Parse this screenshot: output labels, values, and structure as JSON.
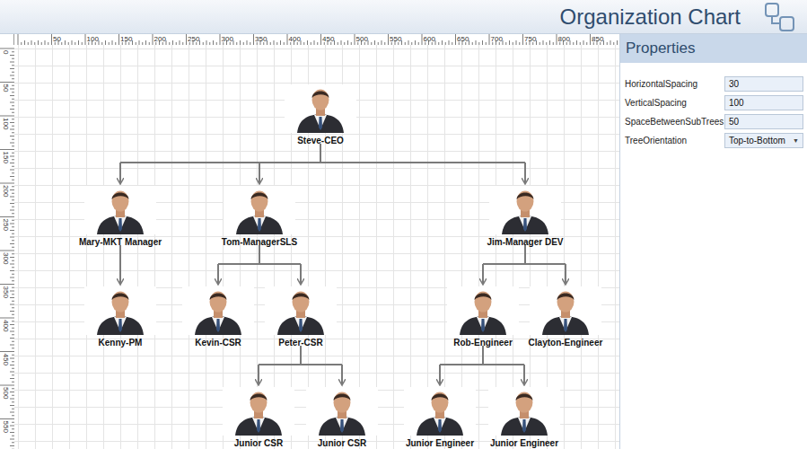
{
  "window": {
    "title": "Organization Chart"
  },
  "rulers": {
    "top": [
      "50",
      "100",
      "150",
      "200",
      "250",
      "300",
      "350",
      "400",
      "450",
      "500",
      "550",
      "600",
      "650",
      "700",
      "750",
      "800",
      "850"
    ],
    "left": [
      "0",
      "50",
      "100",
      "150",
      "200",
      "250",
      "300",
      "350",
      "400",
      "450",
      "500",
      "550"
    ]
  },
  "chart": {
    "root": {
      "name": "Steve-CEO",
      "children": [
        {
          "name": "Mary-MKT Manager",
          "children": [
            {
              "name": "Kenny-PM",
              "children": []
            }
          ]
        },
        {
          "name": "Tom-ManagerSLS",
          "children": [
            {
              "name": "Kevin-CSR",
              "children": []
            },
            {
              "name": "Peter-CSR",
              "children": [
                {
                  "name": "Junior CSR",
                  "children": []
                },
                {
                  "name": "Junior CSR",
                  "children": []
                }
              ]
            }
          ]
        },
        {
          "name": "Jim-Manager DEV",
          "children": [
            {
              "name": "Rob-Engineer",
              "children": [
                {
                  "name": "Junior Engineer",
                  "children": []
                },
                {
                  "name": "Junior Engineer",
                  "children": []
                }
              ]
            },
            {
              "name": "Clayton-Engineer",
              "children": []
            }
          ]
        }
      ]
    }
  },
  "properties": {
    "title": "Properties",
    "fields": [
      {
        "label": "HorizontalSpacing",
        "value": "30",
        "kind": "number"
      },
      {
        "label": "VerticalSpacing",
        "value": "100",
        "kind": "number"
      },
      {
        "label": "SpaceBetweenSubTrees",
        "value": "50",
        "kind": "number"
      },
      {
        "label": "TreeOrientation",
        "value": "Top-to-Bottom",
        "kind": "dropdown",
        "icon": "▼"
      }
    ]
  }
}
